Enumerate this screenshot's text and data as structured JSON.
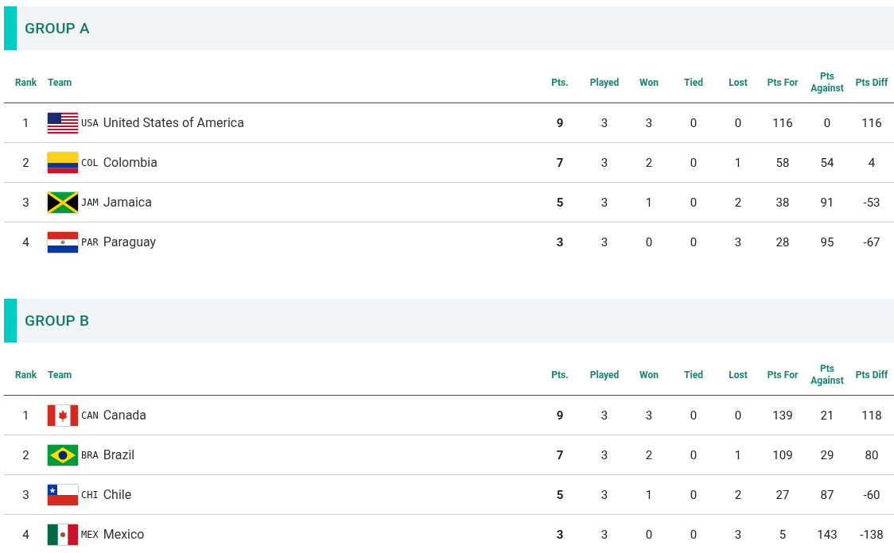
{
  "groups": [
    {
      "title": "GROUP A",
      "columns": [
        "Rank",
        "Team",
        "Pts.",
        "Played",
        "Won",
        "Tied",
        "Lost",
        "Pts For",
        "Pts Against",
        "Pts Diff"
      ],
      "rows": [
        {
          "rank": "1",
          "code": "USA",
          "team": "United States of America",
          "pts": "9",
          "played": "3",
          "won": "3",
          "tied": "0",
          "lost": "0",
          "pts_for": "116",
          "pts_against": "0",
          "pts_diff": "116"
        },
        {
          "rank": "2",
          "code": "COL",
          "team": "Colombia",
          "pts": "7",
          "played": "3",
          "won": "2",
          "tied": "0",
          "lost": "1",
          "pts_for": "58",
          "pts_against": "54",
          "pts_diff": "4"
        },
        {
          "rank": "3",
          "code": "JAM",
          "team": "Jamaica",
          "pts": "5",
          "played": "3",
          "won": "1",
          "tied": "0",
          "lost": "2",
          "pts_for": "38",
          "pts_against": "91",
          "pts_diff": "-53"
        },
        {
          "rank": "4",
          "code": "PAR",
          "team": "Paraguay",
          "pts": "3",
          "played": "3",
          "won": "0",
          "tied": "0",
          "lost": "3",
          "pts_for": "28",
          "pts_against": "95",
          "pts_diff": "-67"
        }
      ]
    },
    {
      "title": "GROUP B",
      "columns": [
        "Rank",
        "Team",
        "Pts.",
        "Played",
        "Won",
        "Tied",
        "Lost",
        "Pts For",
        "Pts Against",
        "Pts Diff"
      ],
      "rows": [
        {
          "rank": "1",
          "code": "CAN",
          "team": "Canada",
          "pts": "9",
          "played": "3",
          "won": "3",
          "tied": "0",
          "lost": "0",
          "pts_for": "139",
          "pts_against": "21",
          "pts_diff": "118"
        },
        {
          "rank": "2",
          "code": "BRA",
          "team": "Brazil",
          "pts": "7",
          "played": "3",
          "won": "2",
          "tied": "0",
          "lost": "1",
          "pts_for": "109",
          "pts_against": "29",
          "pts_diff": "80"
        },
        {
          "rank": "3",
          "code": "CHI",
          "team": "Chile",
          "pts": "5",
          "played": "3",
          "won": "1",
          "tied": "0",
          "lost": "2",
          "pts_for": "27",
          "pts_against": "87",
          "pts_diff": "-60"
        },
        {
          "rank": "4",
          "code": "MEX",
          "team": "Mexico",
          "pts": "3",
          "played": "3",
          "won": "0",
          "tied": "0",
          "lost": "3",
          "pts_for": "5",
          "pts_against": "143",
          "pts_diff": "-138"
        }
      ]
    }
  ]
}
